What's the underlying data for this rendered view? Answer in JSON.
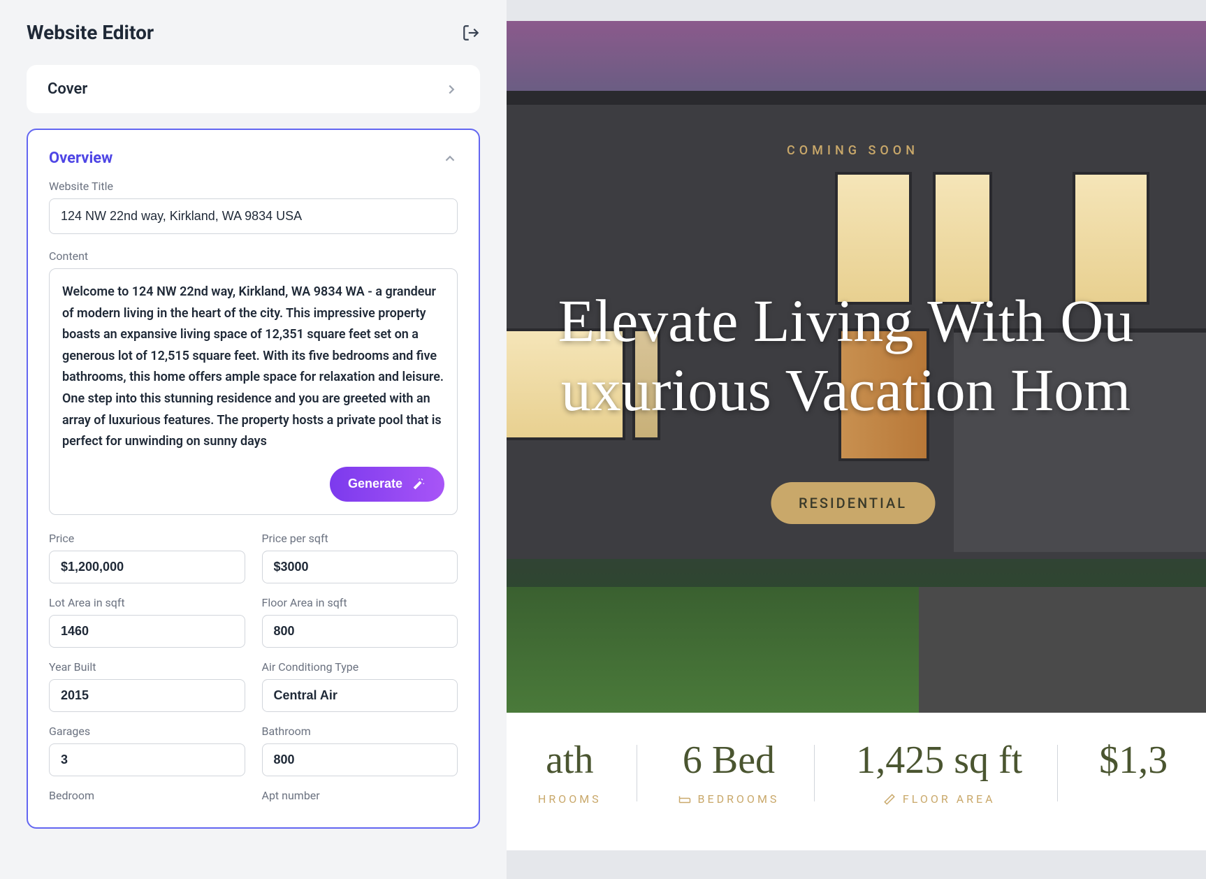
{
  "editor": {
    "title": "Website Editor",
    "sections": {
      "cover": {
        "title": "Cover"
      },
      "overview": {
        "title": "Overview",
        "website_title_label": "Website Title",
        "website_title_value": "124 NW 22nd way, Kirkland, WA 9834 USA",
        "content_label": "Content",
        "content_value": "Welcome to 124 NW 22nd way, Kirkland, WA 9834 WA - a grandeur of modern living in the heart of the city. This impressive property boasts an expansive living space of 12,351 square feet set on a generous lot of 12,515 square feet. With its five bedrooms and five bathrooms, this home offers ample space for relaxation and leisure. One step into this stunning residence and you are greeted with an array of luxurious features. The property hosts a private pool that is perfect for unwinding on sunny days",
        "generate_label": "Generate",
        "fields": {
          "price": {
            "label": "Price",
            "value": "$1,200,000"
          },
          "price_per_sqft": {
            "label": "Price per sqft",
            "value": "$3000"
          },
          "lot_area": {
            "label": "Lot Area in sqft",
            "value": "1460"
          },
          "floor_area": {
            "label": "Floor Area in sqft",
            "value": "800"
          },
          "year_built": {
            "label": "Year Built",
            "value": "2015"
          },
          "ac_type": {
            "label": "Air Conditiong Type",
            "value": "Central Air"
          },
          "garages": {
            "label": "Garages",
            "value": "3"
          },
          "bathroom": {
            "label": "Bathroom",
            "value": "800"
          },
          "bedroom": {
            "label": "Bedroom",
            "value": ""
          },
          "apt_number": {
            "label": "Apt number",
            "value": ""
          }
        }
      }
    }
  },
  "preview": {
    "coming_soon": "COMING SOON",
    "hero_title_line1": "Elevate Living With Ou",
    "hero_title_line2": "uxurious Vacation Hom",
    "pill": "RESIDENTIAL",
    "stats": {
      "bath": {
        "value": "ath",
        "label": "HROOMS"
      },
      "bed": {
        "value": "6 Bed",
        "label": "BEDROOMS"
      },
      "floor": {
        "value": "1,425 sq ft",
        "label": "FLOOR AREA"
      },
      "price": {
        "value": "$1,3"
      }
    }
  }
}
